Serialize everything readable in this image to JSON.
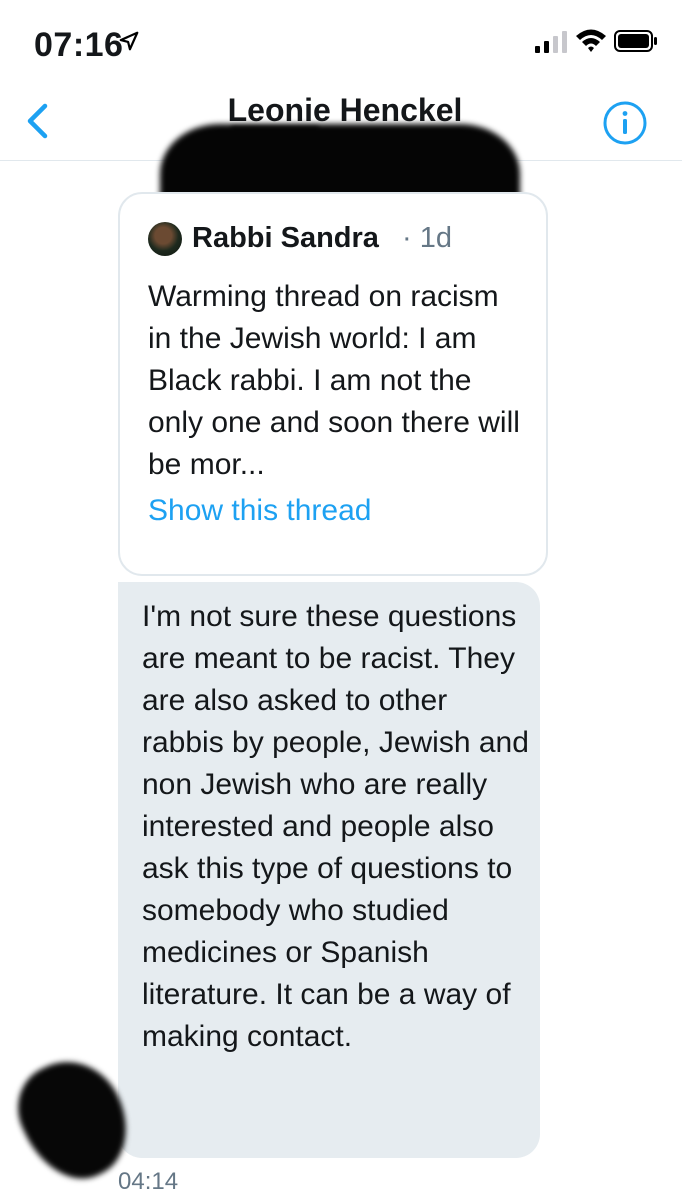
{
  "status_bar": {
    "time": "07:16",
    "icons": [
      "location-arrow-icon",
      "cellular-signal-icon",
      "wifi-icon",
      "battery-icon"
    ]
  },
  "header": {
    "title": "Leonie Henckel",
    "handle": "@",
    "back_icon": "chevron-left-icon",
    "info_icon": "info-icon",
    "accent_color": "#1da1f2"
  },
  "quoted_tweet": {
    "author": "Rabbi Sandra",
    "time": "· 1d",
    "text": "Warming thread on racism in the Jewish world: I am Black rabbi. I am not the only one and soon there will be mor...",
    "link": "Show this thread"
  },
  "message": {
    "text": "I'm not sure these questions are meant to be racist. They are also asked to other rabbis by people, Jewish and non Jewish who are really interested and people also ask this type of questions to somebody who studied medicines or Spanish literature. It can be a way of making contact.",
    "timestamp": "04:14",
    "bubble_color": "#e6ecf0"
  }
}
